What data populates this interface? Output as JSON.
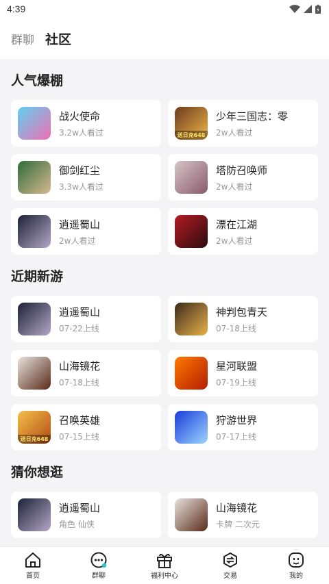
{
  "status_bar": {
    "time": "4:39"
  },
  "header": {
    "tabs": [
      {
        "label": "群聊"
      },
      {
        "label": "社区"
      }
    ]
  },
  "sections": [
    {
      "title": "人气爆棚",
      "items": [
        {
          "title": "战火使命",
          "sub": "3.2w人看过",
          "icon": "game-icon",
          "colors": [
            "#5fd0f3",
            "#ef6fb0"
          ]
        },
        {
          "title": "少年三国志：零",
          "sub": "2w人看过",
          "icon": "game-icon",
          "colors": [
            "#6b3a1e",
            "#f0b447"
          ],
          "badge": "送日充648"
        },
        {
          "title": "御剑红尘",
          "sub": "3.3w人看过",
          "icon": "game-icon",
          "colors": [
            "#2f6b3a",
            "#d7b98f"
          ]
        },
        {
          "title": "塔防召唤师",
          "sub": "2w人看过",
          "icon": "game-icon",
          "colors": [
            "#d6c4c8",
            "#8a5a6c"
          ]
        },
        {
          "title": "逍遥蜀山",
          "sub": "2w人看过",
          "icon": "game-icon",
          "colors": [
            "#1c2236",
            "#b3a7c6"
          ]
        },
        {
          "title": "漂在江湖",
          "sub": "2w人看过",
          "icon": "game-icon",
          "colors": [
            "#b31a22",
            "#2d0d10"
          ]
        }
      ]
    },
    {
      "title": "近期新游",
      "items": [
        {
          "title": "逍遥蜀山",
          "sub": "07-22上线",
          "icon": "game-icon",
          "colors": [
            "#1c2236",
            "#b3a7c6"
          ]
        },
        {
          "title": "神判包青天",
          "sub": "07-18上线",
          "icon": "game-icon",
          "colors": [
            "#3b2a1a",
            "#e8b14a"
          ]
        },
        {
          "title": "山海镜花",
          "sub": "07-18上线",
          "icon": "game-icon",
          "colors": [
            "#e7e2dc",
            "#5a2a1a"
          ]
        },
        {
          "title": "星河联盟",
          "sub": "07-19上线",
          "icon": "game-icon",
          "colors": [
            "#ff7a00",
            "#b31d00"
          ]
        },
        {
          "title": "召唤英雄",
          "sub": "07-15上线",
          "icon": "game-icon",
          "colors": [
            "#f4c04b",
            "#b24a12"
          ],
          "badge": "送日充648"
        },
        {
          "title": "狩游世界",
          "sub": "07-17上线",
          "icon": "game-icon",
          "colors": [
            "#1a3bd9",
            "#9ad5ff"
          ]
        }
      ]
    },
    {
      "title": "猜你想逛",
      "items": [
        {
          "title": "逍遥蜀山",
          "sub": "角色 仙侠",
          "icon": "game-icon",
          "colors": [
            "#1c2236",
            "#b3a7c6"
          ]
        },
        {
          "title": "山海镜花",
          "sub": "卡牌 二次元",
          "icon": "game-icon",
          "colors": [
            "#e7e2dc",
            "#5a2a1a"
          ]
        }
      ]
    }
  ],
  "bottom_nav": [
    {
      "label": "首页",
      "icon": "home-icon"
    },
    {
      "label": "群聊",
      "icon": "chat-icon"
    },
    {
      "label": "福利中心",
      "icon": "gift-icon"
    },
    {
      "label": "交易",
      "icon": "trade-icon"
    },
    {
      "label": "我的",
      "icon": "profile-icon"
    }
  ]
}
